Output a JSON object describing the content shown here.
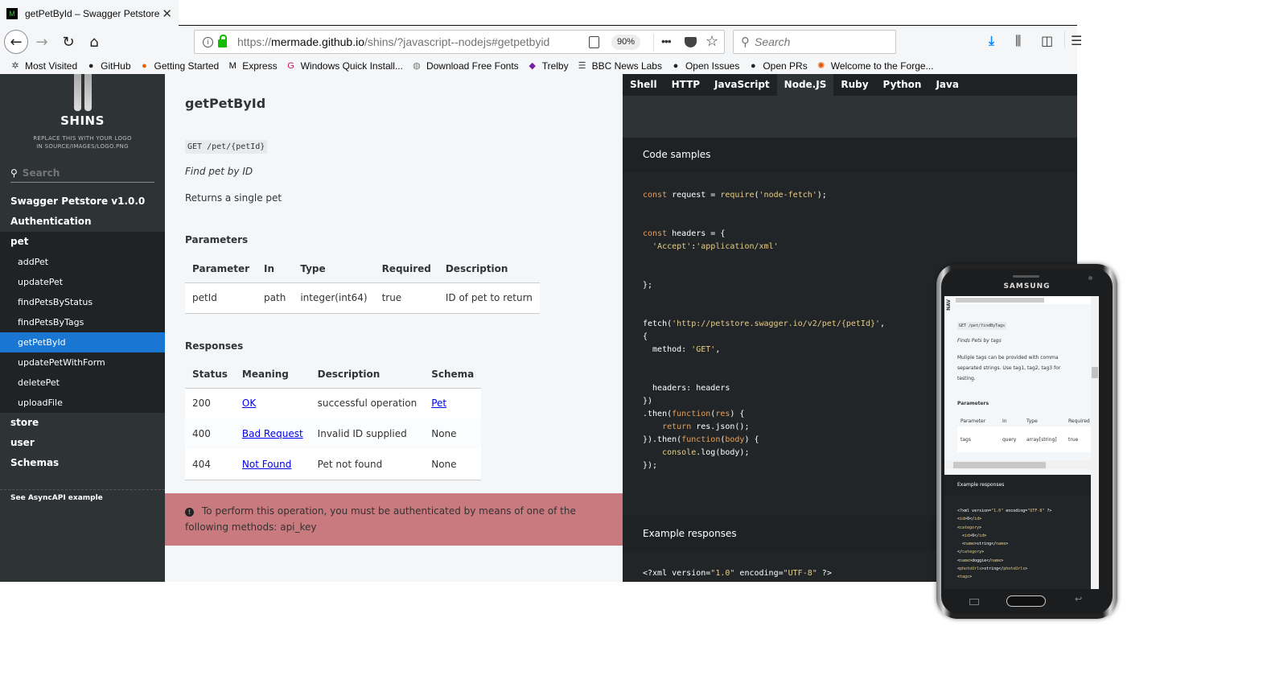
{
  "browser": {
    "tab": {
      "favicon": "M",
      "title": "getPetById – Swagger Petstore v",
      "close": "✕"
    },
    "nav": {
      "back": "←",
      "forward": "→",
      "reload": "↻",
      "home": "⌂"
    },
    "url": {
      "prefix": "https://",
      "host": "mermade.github.io",
      "path": "/shins/?javascript--nodejs#getpetbyid"
    },
    "zoom": "90%",
    "more": "•••",
    "search_placeholder": "Search",
    "bookmarks": [
      {
        "label": "Most Visited",
        "icon": "gear-icon",
        "glyph": "✲",
        "color": "#444"
      },
      {
        "label": "GitHub",
        "icon": "github-icon",
        "glyph": "●",
        "color": "#222"
      },
      {
        "label": "Getting Started",
        "icon": "firefox-icon",
        "glyph": "●",
        "color": "#e66000"
      },
      {
        "label": "Express",
        "icon": "express-icon",
        "glyph": "M",
        "color": "#000"
      },
      {
        "label": "Windows Quick Install...",
        "icon": "g-icon",
        "glyph": "G",
        "color": "#c2185b"
      },
      {
        "label": "Download Free Fonts",
        "icon": "globe-icon",
        "glyph": "◍",
        "color": "#777"
      },
      {
        "label": "Trelby",
        "icon": "trelby-icon",
        "glyph": "◆",
        "color": "#7b1fa2"
      },
      {
        "label": "BBC News Labs",
        "icon": "rss-icon",
        "glyph": "☰",
        "color": "#444"
      },
      {
        "label": "Open Issues",
        "icon": "github-icon",
        "glyph": "●",
        "color": "#222"
      },
      {
        "label": "Open PRs",
        "icon": "github-icon",
        "glyph": "●",
        "color": "#222"
      },
      {
        "label": "Welcome to the Forge...",
        "icon": "forge-icon",
        "glyph": "✺",
        "color": "#e65100"
      }
    ]
  },
  "sidebar": {
    "logo_name": "SHINS",
    "logo_sub_1": "REPLACE THIS WITH YOUR LOGO",
    "logo_sub_2": "IN SOURCE/IMAGES/LOGO.PNG",
    "search_placeholder": "Search",
    "toc_top": [
      "Swagger Petstore v1.0.0",
      "Authentication",
      "pet"
    ],
    "toc_pet": [
      "addPet",
      "updatePet",
      "findPetsByStatus",
      "findPetsByTags",
      "getPetById",
      "updatePetWithForm",
      "deletePet",
      "uploadFile"
    ],
    "toc_bottom": [
      "store",
      "user",
      "Schemas"
    ],
    "active_item": "getPetById",
    "footer_link": "See AsyncAPI example"
  },
  "content": {
    "title": "getPetById",
    "endpoint": "GET /pet/{petId}",
    "summary": "Find pet by ID",
    "description": "Returns a single pet",
    "params_heading": "Parameters",
    "params_headers": [
      "Parameter",
      "In",
      "Type",
      "Required",
      "Description"
    ],
    "params_rows": [
      [
        "petId",
        "path",
        "integer(int64)",
        "true",
        "ID of pet to return"
      ]
    ],
    "responses_heading": "Responses",
    "responses_headers": [
      "Status",
      "Meaning",
      "Description",
      "Schema"
    ],
    "responses_rows": [
      {
        "status": "200",
        "meaning": "OK",
        "description": "successful operation",
        "schema": "Pet",
        "schema_link": true
      },
      {
        "status": "400",
        "meaning": "Bad Request",
        "description": "Invalid ID supplied",
        "schema": "None",
        "schema_link": false
      },
      {
        "status": "404",
        "meaning": "Not Found",
        "description": "Pet not found",
        "schema": "None",
        "schema_link": false
      }
    ],
    "auth_warning": "To perform this operation, you must be authenticated by means of one of the following methods: api_key"
  },
  "code_panel": {
    "tabs": [
      "Shell",
      "HTTP",
      "JavaScript",
      "Node.JS",
      "Ruby",
      "Python",
      "Java"
    ],
    "active_tab": "Node.JS",
    "code_samples_heading": "Code samples",
    "example_responses_heading": "Example responses",
    "example_first_line": "<?xml version=\"1.0\" encoding=\"UTF-8\" ?>"
  },
  "phone": {
    "brand": "SAMSUNG",
    "nav_label": "NAV",
    "endpoint": "GET /pet/findByTags",
    "summary": "Finds Pets by tags",
    "description": "Muliple tags can be provided with comma separated strings. Use tag1, tag2, tag3 for testing.",
    "params_heading": "Parameters",
    "params_headers": [
      "Parameter",
      "In",
      "Type",
      "Required"
    ],
    "params_row": [
      "tags",
      "query",
      "array[string]",
      "true"
    ],
    "example_heading": "Example responses"
  },
  "colors": {
    "sidebar_bg": "#2e3336",
    "active_item": "#1976d2",
    "warning_bg": "#c97a7e",
    "link": "#0000ee",
    "code_keyword": "#e3a15e",
    "code_string": "#e4cc8a"
  }
}
